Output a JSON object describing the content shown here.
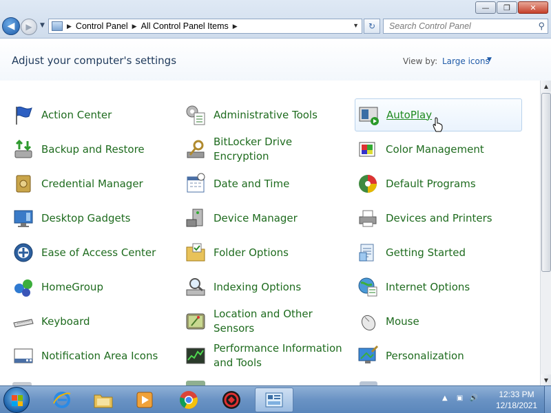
{
  "address": {
    "segments": [
      "Control Panel",
      "All Control Panel Items"
    ]
  },
  "search": {
    "placeholder": "Search Control Panel"
  },
  "header": {
    "title": "Adjust your computer's settings",
    "view_by_label": "View by:",
    "view_by_value": "Large icons"
  },
  "items": [
    {
      "label": "Action Center",
      "icon": "flag-icon"
    },
    {
      "label": "Administrative Tools",
      "icon": "admin-tools-icon"
    },
    {
      "label": "AutoPlay",
      "icon": "autoplay-icon"
    },
    {
      "label": "Backup and Restore",
      "icon": "backup-icon"
    },
    {
      "label": "BitLocker Drive Encryption",
      "icon": "bitlocker-icon"
    },
    {
      "label": "Color Management",
      "icon": "color-icon"
    },
    {
      "label": "Credential Manager",
      "icon": "vault-icon"
    },
    {
      "label": "Date and Time",
      "icon": "calendar-icon"
    },
    {
      "label": "Default Programs",
      "icon": "default-programs-icon"
    },
    {
      "label": "Desktop Gadgets",
      "icon": "gadgets-icon"
    },
    {
      "label": "Device Manager",
      "icon": "device-manager-icon"
    },
    {
      "label": "Devices and Printers",
      "icon": "printer-icon"
    },
    {
      "label": "Ease of Access Center",
      "icon": "accessibility-icon"
    },
    {
      "label": "Folder Options",
      "icon": "folder-icon"
    },
    {
      "label": "Getting Started",
      "icon": "getting-started-icon"
    },
    {
      "label": "HomeGroup",
      "icon": "homegroup-icon"
    },
    {
      "label": "Indexing Options",
      "icon": "indexing-icon"
    },
    {
      "label": "Internet Options",
      "icon": "internet-icon"
    },
    {
      "label": "Keyboard",
      "icon": "keyboard-icon"
    },
    {
      "label": "Location and Other Sensors",
      "icon": "gps-icon"
    },
    {
      "label": "Mouse",
      "icon": "mouse-icon"
    },
    {
      "label": "Notification Area Icons",
      "icon": "notification-icon"
    },
    {
      "label": "Performance Information and Tools",
      "icon": "performance-icon"
    },
    {
      "label": "Personalization",
      "icon": "personalization-icon"
    }
  ],
  "taskbar": {
    "apps": [
      "explorer-icon",
      "internet-explorer-icon",
      "file-explorer-icon",
      "media-player-icon",
      "chrome-icon",
      "app-red-icon",
      "control-panel-icon"
    ],
    "time": "12:33 PM",
    "date": "12/18/2021"
  }
}
